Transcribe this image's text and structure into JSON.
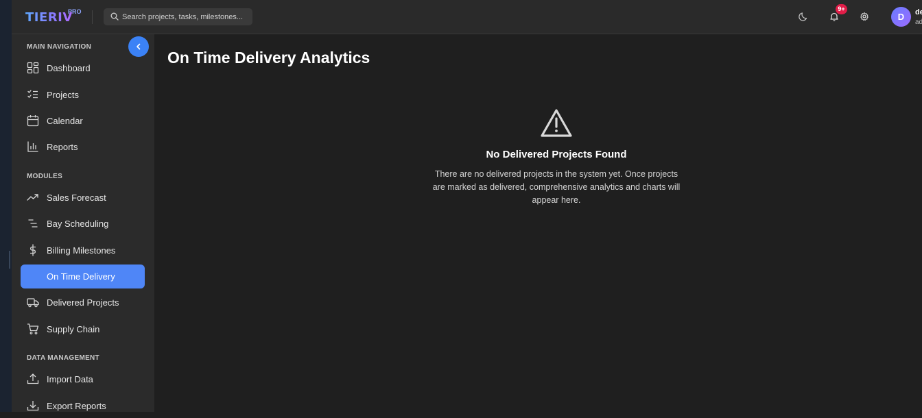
{
  "header": {
    "logo": "TIERIV",
    "logo_badge": "PRO",
    "search_placeholder": "Search projects, tasks, milestones...",
    "notification_count": "9+",
    "user_initial": "D",
    "user_name": "de",
    "user_role": "ad"
  },
  "sidebar": {
    "sections": {
      "main": "MAIN NAVIGATION",
      "modules": "MODULES",
      "data": "DATA MANAGEMENT"
    },
    "items": {
      "dashboard": "Dashboard",
      "projects": "Projects",
      "calendar": "Calendar",
      "reports": "Reports",
      "sales_forecast": "Sales Forecast",
      "bay_scheduling": "Bay Scheduling",
      "billing_milestones": "Billing Milestones",
      "on_time_delivery": "On Time Delivery",
      "delivered_projects": "Delivered Projects",
      "supply_chain": "Supply Chain",
      "import_data": "Import Data",
      "export_reports": "Export Reports"
    },
    "active_item": "on_time_delivery"
  },
  "main": {
    "title": "On Time Delivery Analytics",
    "empty_state": {
      "icon": "warning-triangle-icon",
      "title": "No Delivered Projects Found",
      "message": "There are no delivered projects in the system yet. Once projects are marked as delivered, comprehensive analytics and charts will appear here."
    }
  },
  "colors": {
    "accent": "#4f86f7",
    "badge": "#e11d48",
    "sidebar_bg": "#2b2b2b",
    "main_bg": "#1f1f1f"
  }
}
